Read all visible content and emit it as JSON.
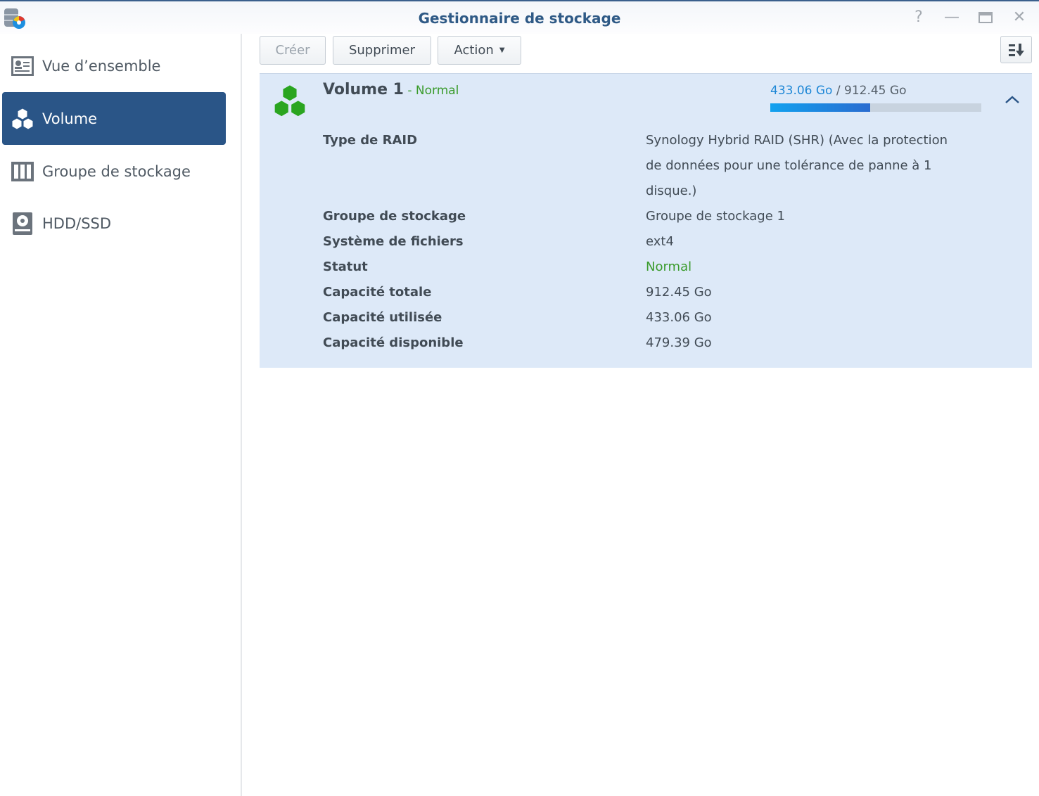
{
  "window": {
    "title": "Gestionnaire de stockage"
  },
  "sidebar": {
    "items": [
      {
        "label": "Vue d’ensemble",
        "icon": "overview-icon"
      },
      {
        "label": "Volume",
        "icon": "volume-icon",
        "active": true
      },
      {
        "label": "Groupe de stockage",
        "icon": "storage-pool-icon"
      },
      {
        "label": "HDD/SSD",
        "icon": "hdd-icon"
      }
    ]
  },
  "toolbar": {
    "create": "Créer",
    "delete": "Supprimer",
    "action": "Action"
  },
  "volume": {
    "name": "Volume 1",
    "status": " - Normal",
    "used": "433.06 Go",
    "sep": " / ",
    "total": "912.45 Go",
    "usage_fraction": 0.4746,
    "details": [
      {
        "label": "Type de RAID",
        "value": "Synology Hybrid RAID (SHR) (Avec la protection de données pour une tolérance de panne à 1 disque.)"
      },
      {
        "label": "Groupe de stockage",
        "value": "Groupe de stockage 1"
      },
      {
        "label": "Système de fichiers",
        "value": "ext4"
      },
      {
        "label": "Statut",
        "value": "Normal"
      },
      {
        "label": "Capacité totale",
        "value": "912.45 Go"
      },
      {
        "label": "Capacité utilisée",
        "value": "433.06 Go"
      },
      {
        "label": "Capacité disponible",
        "value": "479.39 Go"
      }
    ]
  },
  "colors": {
    "accent": "#2a5587",
    "normal": "#3a9b2c",
    "used": "#1e87d6"
  }
}
